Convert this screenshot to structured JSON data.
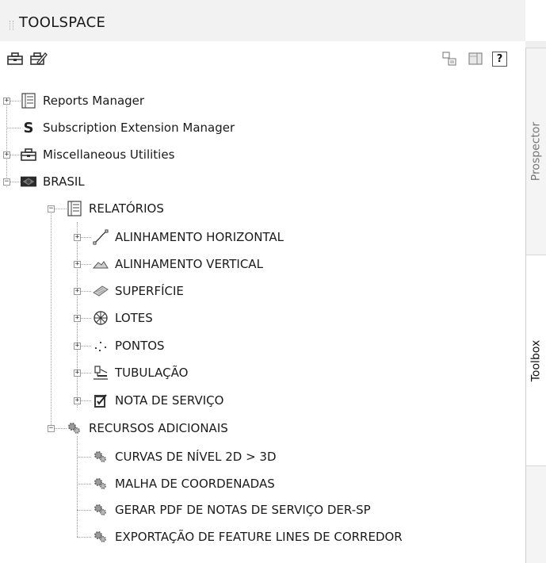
{
  "panel": {
    "title": "TOOLSPACE"
  },
  "toolbar": {
    "left_icons": [
      "toolbox-icon",
      "edit-toolbox-icon"
    ],
    "right_icons": [
      "copy-layout-icon",
      "display-mode-icon"
    ],
    "help_label": "?"
  },
  "tree": {
    "reports_manager": "Reports Manager",
    "subscription_manager": "Subscription Extension Manager",
    "misc_utilities": "Miscellaneous Utilities",
    "brasil": "BRASIL",
    "relatorios": "RELATÓRIOS",
    "alinhamento_horizontal": "ALINHAMENTO HORIZONTAL",
    "alinhamento_vertical": "ALINHAMENTO VERTICAL",
    "superficie": "SUPERFÍCIE",
    "lotes": "LOTES",
    "pontos": "PONTOS",
    "tubulacao": "TUBULAÇÃO",
    "nota_servico": "NOTA DE SERVIÇO",
    "recursos_adicionais": "RECURSOS ADICIONAIS",
    "curvas_nivel": "CURVAS DE NÍVEL 2D > 3D",
    "malha_coordenadas": "MALHA DE COORDENADAS",
    "gerar_pdf": "GERAR PDF DE NOTAS DE SERVIÇO DER-SP",
    "exportacao_feature": "EXPORTAÇÃO DE FEATURE LINES DE CORREDOR"
  },
  "tabs": {
    "prospector": "Prospector",
    "toolbox": "Toolbox"
  }
}
